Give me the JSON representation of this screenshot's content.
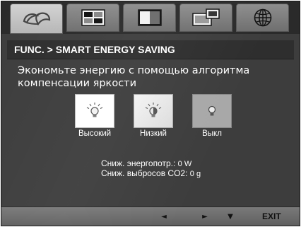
{
  "tabs": [
    {
      "icon": "eco-leaf-icon",
      "active": true
    },
    {
      "icon": "picture-settings-icon",
      "active": false
    },
    {
      "icon": "color-settings-icon",
      "active": false
    },
    {
      "icon": "display-setup-icon",
      "active": false
    },
    {
      "icon": "globe-language-icon",
      "active": false
    }
  ],
  "header": {
    "title": "FUNC.  >  SMART ENERGY SAVING"
  },
  "description": {
    "line1": "Экономьте энергию с помощью алгоритма",
    "line2": "компенсации яркости"
  },
  "options": [
    {
      "label": "Высокий",
      "icon": "bulb-bright-icon"
    },
    {
      "label": "Низкий",
      "icon": "bulb-dim-icon"
    },
    {
      "label": "Выкл",
      "icon": "bulb-off-icon",
      "selected": true
    }
  ],
  "stats": {
    "energy_label": "Сниж. энергопотр.:",
    "energy_value": "0  W",
    "co2_label": "Сниж. выбросов CO2:",
    "co2_value": "0  g"
  },
  "footer": {
    "left": "◄",
    "right": "►",
    "down": "▼",
    "exit": "EXIT"
  },
  "colors": {
    "background": "#3d3d3d",
    "tab_active": "#c4c4c4",
    "tab_inactive": "#7e7e7e",
    "text": "#ffffff"
  }
}
